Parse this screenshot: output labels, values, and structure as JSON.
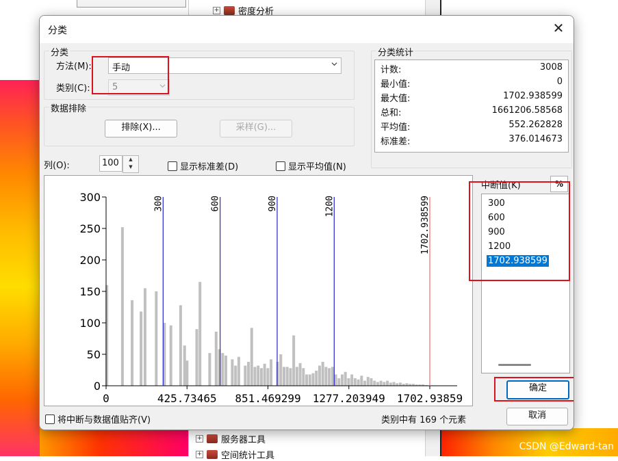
{
  "background": {
    "tree_items": [
      {
        "label": "密度分析"
      },
      {
        "label": "服务器工具"
      },
      {
        "label": "空间统计工具"
      }
    ],
    "watermark": "CSDN @Edward-tan"
  },
  "dialog": {
    "title": "分类",
    "classification": {
      "group_label": "分类",
      "method_label": "方法(M):",
      "method_value": "手动",
      "classes_label": "类别(C):",
      "classes_value": "5"
    },
    "exclusion": {
      "group_label": "数据排除",
      "exclude_button": "排除(X)...",
      "sample_button": "采样(G)..."
    },
    "stats": {
      "group_label": "分类统计",
      "rows": [
        {
          "label": "计数:",
          "value": "3008"
        },
        {
          "label": "最小值:",
          "value": "0"
        },
        {
          "label": "最大值:",
          "value": "1702.938599"
        },
        {
          "label": "总和:",
          "value": "1661206.58568"
        },
        {
          "label": "平均值:",
          "value": "552.262828"
        },
        {
          "label": "标准差:",
          "value": "376.014673"
        }
      ]
    },
    "columns_label": "列(O):",
    "columns_value": "100",
    "show_std_label": "显示标准差(D)",
    "show_mean_label": "显示平均值(N)",
    "breaks_label": "中断值(K)",
    "percent_button": "%",
    "breaks": [
      "300",
      "600",
      "900",
      "1200",
      "1702.938599"
    ],
    "selected_break": 4,
    "ok_button": "确定",
    "cancel_button": "取消",
    "snap_label": "将中断与数据值贴齐(V)",
    "status_prefix": "类别中有",
    "status_count": "169",
    "status_suffix": "个元素"
  },
  "chart_data": {
    "type": "bar",
    "xlim": [
      0,
      1702.938599
    ],
    "ylim": [
      0,
      300
    ],
    "y_ticks": [
      "0",
      "50",
      "100",
      "150",
      "200",
      "250",
      "300"
    ],
    "x_ticks": [
      {
        "value": 0,
        "label": "0"
      },
      {
        "value": 425.73465,
        "label": "425.73465"
      },
      {
        "value": 851.469299,
        "label": "851.469299"
      },
      {
        "value": 1277.203949,
        "label": "1277.203949"
      },
      {
        "value": 1702.938599,
        "label": "1702.93859"
      }
    ],
    "break_lines": [
      {
        "value": 300,
        "label": "300",
        "color": "#2222cc"
      },
      {
        "value": 600,
        "label": "600",
        "color": "#2222cc"
      },
      {
        "value": 900,
        "label": "900",
        "color": "#2222cc"
      },
      {
        "value": 1200,
        "label": "1200",
        "color": "#2222cc"
      },
      {
        "value": 1702.938599,
        "label": "1702.938599",
        "color": "#e87070"
      }
    ],
    "bar_color": "#c0c0c0",
    "bars": [
      [
        4,
        160
      ],
      [
        86,
        252
      ],
      [
        137,
        136
      ],
      [
        184,
        118
      ],
      [
        205,
        155
      ],
      [
        264,
        150
      ],
      [
        307,
        100
      ],
      [
        341,
        96
      ],
      [
        392,
        128
      ],
      [
        413,
        64
      ],
      [
        426,
        40
      ],
      [
        477,
        90
      ],
      [
        494,
        165
      ],
      [
        545,
        52
      ],
      [
        579,
        86
      ],
      [
        596,
        58
      ],
      [
        613,
        52
      ],
      [
        630,
        48
      ],
      [
        664,
        42
      ],
      [
        681,
        32
      ],
      [
        698,
        46
      ],
      [
        732,
        32
      ],
      [
        749,
        38
      ],
      [
        766,
        92
      ],
      [
        783,
        30
      ],
      [
        800,
        32
      ],
      [
        817,
        28
      ],
      [
        834,
        35
      ],
      [
        851,
        28
      ],
      [
        868,
        42
      ],
      [
        902,
        38
      ],
      [
        919,
        50
      ],
      [
        936,
        30
      ],
      [
        953,
        30
      ],
      [
        970,
        28
      ],
      [
        987,
        80
      ],
      [
        1004,
        30
      ],
      [
        1021,
        36
      ],
      [
        1038,
        28
      ],
      [
        1055,
        18
      ],
      [
        1072,
        18
      ],
      [
        1089,
        20
      ],
      [
        1106,
        24
      ],
      [
        1123,
        32
      ],
      [
        1140,
        38
      ],
      [
        1157,
        30
      ],
      [
        1174,
        28
      ],
      [
        1191,
        30
      ],
      [
        1208,
        18
      ],
      [
        1225,
        12
      ],
      [
        1242,
        18
      ],
      [
        1259,
        22
      ],
      [
        1276,
        12
      ],
      [
        1293,
        18
      ],
      [
        1310,
        12
      ],
      [
        1327,
        10
      ],
      [
        1344,
        16
      ],
      [
        1361,
        8
      ],
      [
        1378,
        14
      ],
      [
        1395,
        12
      ],
      [
        1412,
        8
      ],
      [
        1429,
        6
      ],
      [
        1446,
        8
      ],
      [
        1463,
        6
      ],
      [
        1480,
        8
      ],
      [
        1497,
        5
      ],
      [
        1514,
        6
      ],
      [
        1531,
        4
      ],
      [
        1548,
        5
      ],
      [
        1565,
        3
      ],
      [
        1582,
        4
      ],
      [
        1599,
        3
      ],
      [
        1616,
        3
      ],
      [
        1633,
        2
      ],
      [
        1650,
        2
      ],
      [
        1667,
        2
      ],
      [
        1684,
        1
      ]
    ]
  }
}
